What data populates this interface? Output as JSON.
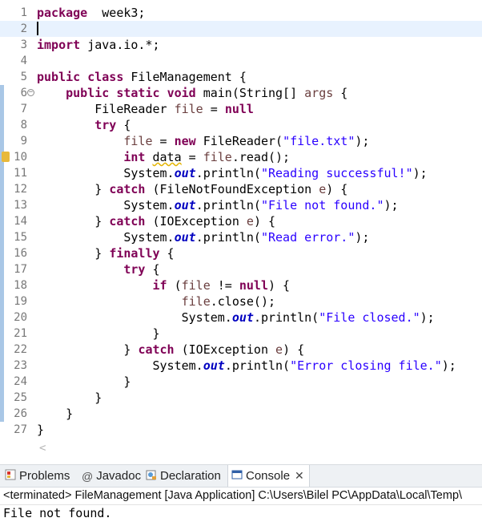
{
  "editor": {
    "lines": [
      {
        "n": "1",
        "t": [
          [
            "k",
            "package"
          ],
          [
            "",
            "  week3;"
          ]
        ]
      },
      {
        "n": "2",
        "t": []
      },
      {
        "n": "3",
        "t": [
          [
            "k",
            "import"
          ],
          [
            "",
            " java.io.*;"
          ]
        ]
      },
      {
        "n": "4",
        "t": []
      },
      {
        "n": "5",
        "t": [
          [
            "k",
            "public"
          ],
          [
            "",
            " "
          ],
          [
            "k",
            "class"
          ],
          [
            "",
            " FileManagement {"
          ]
        ]
      },
      {
        "n": "6",
        "t": [
          [
            "",
            "    "
          ],
          [
            "k",
            "public"
          ],
          [
            "",
            " "
          ],
          [
            "k",
            "static"
          ],
          [
            "",
            " "
          ],
          [
            "k",
            "void"
          ],
          [
            "",
            " main(String[] "
          ],
          [
            "v",
            "args"
          ],
          [
            "",
            " {"
          ]
        ]
      },
      {
        "n": "7",
        "t": [
          [
            "",
            "        FileReader "
          ],
          [
            "v",
            "file"
          ],
          [
            "",
            " = "
          ],
          [
            "k",
            "null"
          ],
          [
            ";"
          ]
        ]
      },
      {
        "n": "8",
        "t": [
          [
            "",
            "        "
          ],
          [
            "k",
            "try"
          ],
          [
            "",
            " {"
          ]
        ]
      },
      {
        "n": "9",
        "t": [
          [
            "",
            "            "
          ],
          [
            "v",
            "file"
          ],
          [
            "",
            " = "
          ],
          [
            "k",
            "new"
          ],
          [
            "",
            " FileReader("
          ],
          [
            "s",
            "\"file.txt\""
          ],
          [
            "",
            ");"
          ]
        ]
      },
      {
        "n": "10",
        "t": [
          [
            "",
            "            "
          ],
          [
            "k",
            "int"
          ],
          [
            "",
            " "
          ],
          [
            "u",
            "data"
          ],
          [
            "",
            " = "
          ],
          [
            "v",
            "file"
          ],
          [
            "",
            ".read();"
          ]
        ]
      },
      {
        "n": "11",
        "t": [
          [
            "",
            "            System."
          ],
          [
            "f",
            "out"
          ],
          [
            "",
            ".println("
          ],
          [
            "s",
            "\"Reading successful!\""
          ],
          [
            "",
            ");"
          ]
        ]
      },
      {
        "n": "12",
        "t": [
          [
            "",
            "        } "
          ],
          [
            "k",
            "catch"
          ],
          [
            "",
            " (FileNotFoundException "
          ],
          [
            "v",
            "e"
          ],
          [
            "",
            ") {"
          ]
        ]
      },
      {
        "n": "13",
        "t": [
          [
            "",
            "            System."
          ],
          [
            "f",
            "out"
          ],
          [
            "",
            ".println("
          ],
          [
            "s",
            "\"File not found.\""
          ],
          [
            "",
            ");"
          ]
        ]
      },
      {
        "n": "14",
        "t": [
          [
            "",
            "        } "
          ],
          [
            "k",
            "catch"
          ],
          [
            "",
            " (IOException "
          ],
          [
            "v",
            "e"
          ],
          [
            "",
            ") {"
          ]
        ]
      },
      {
        "n": "15",
        "t": [
          [
            "",
            "            System."
          ],
          [
            "f",
            "out"
          ],
          [
            "",
            ".println("
          ],
          [
            "s",
            "\"Read error.\""
          ],
          [
            "",
            ");"
          ]
        ]
      },
      {
        "n": "16",
        "t": [
          [
            "",
            "        } "
          ],
          [
            "k",
            "finally"
          ],
          [
            "",
            " {"
          ]
        ]
      },
      {
        "n": "17",
        "t": [
          [
            "",
            "            "
          ],
          [
            "k",
            "try"
          ],
          [
            "",
            " {"
          ]
        ]
      },
      {
        "n": "18",
        "t": [
          [
            "",
            "                "
          ],
          [
            "k",
            "if"
          ],
          [
            "",
            " ("
          ],
          [
            "v",
            "file"
          ],
          [
            "",
            " != "
          ],
          [
            "k",
            "null"
          ],
          [
            "",
            ") {"
          ]
        ]
      },
      {
        "n": "19",
        "t": [
          [
            "",
            "                    "
          ],
          [
            "v",
            "file"
          ],
          [
            "",
            ".close();"
          ]
        ]
      },
      {
        "n": "20",
        "t": [
          [
            "",
            "                    System."
          ],
          [
            "f",
            "out"
          ],
          [
            "",
            ".println("
          ],
          [
            "s",
            "\"File closed.\""
          ],
          [
            "",
            ");"
          ]
        ]
      },
      {
        "n": "21",
        "t": [
          [
            "",
            "                }"
          ]
        ]
      },
      {
        "n": "22",
        "t": [
          [
            "",
            "            } "
          ],
          [
            "k",
            "catch"
          ],
          [
            "",
            " (IOException "
          ],
          [
            "v",
            "e"
          ],
          [
            "",
            ") {"
          ]
        ]
      },
      {
        "n": "23",
        "t": [
          [
            "",
            "                System."
          ],
          [
            "f",
            "out"
          ],
          [
            "",
            ".println("
          ],
          [
            "s",
            "\"Error closing file.\""
          ],
          [
            "",
            ");"
          ]
        ]
      },
      {
        "n": "24",
        "t": [
          [
            "",
            "            }"
          ]
        ]
      },
      {
        "n": "25",
        "t": [
          [
            "",
            "        }"
          ]
        ]
      },
      {
        "n": "26",
        "t": [
          [
            "",
            "    }"
          ]
        ]
      },
      {
        "n": "27",
        "t": [
          [
            "",
            "}"
          ]
        ]
      }
    ]
  },
  "tabs": {
    "problems": "Problems",
    "javadoc": "Javadoc",
    "declaration": "Declaration",
    "console": "Console",
    "close_glyph": "✕"
  },
  "console": {
    "status": "<terminated> FileManagement [Java Application] C:\\Users\\Bilel PC\\AppData\\Local\\Temp\\",
    "output": "File not found."
  },
  "colors": {
    "keyword": "#7f0055",
    "string": "#2a00ff",
    "field": "#0000c0",
    "local_variable": "#6a3e3e",
    "current_line": "#e8f2fe"
  }
}
